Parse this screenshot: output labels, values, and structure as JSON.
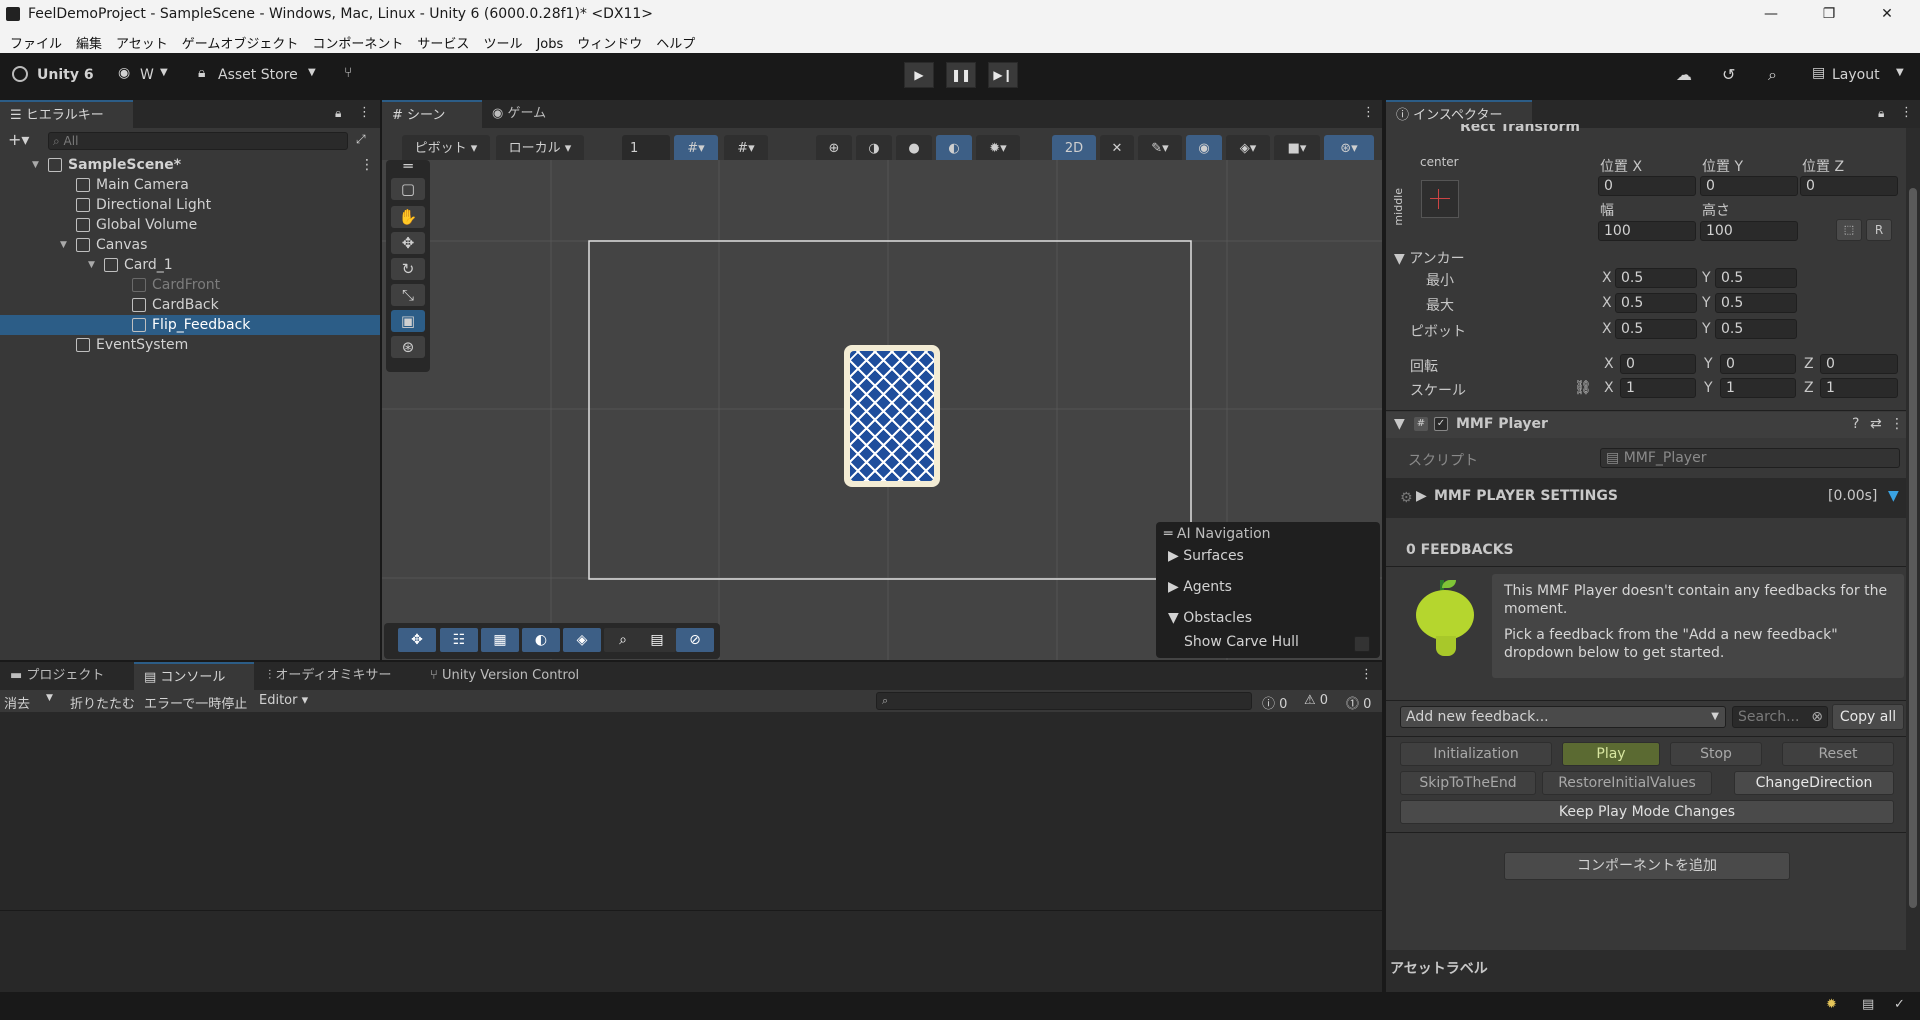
{
  "window": {
    "title": "FeelDemoProject - SampleScene - Windows, Mac, Linux - Unity 6 (6000.0.28f1)* <DX11>",
    "minimize": "—",
    "maximize": "❐",
    "close": "✕"
  },
  "menu": [
    "ファイル",
    "編集",
    "アセット",
    "ゲームオブジェクト",
    "コンポーネント",
    "サービス",
    "ツール",
    "Jobs",
    "ウィンドウ",
    "ヘルプ"
  ],
  "toolbar": {
    "unity_label": "Unity 6",
    "account_label": "W",
    "asset_store_label": "Asset Store",
    "layout_label": "Layout"
  },
  "hierarchy": {
    "tab": "ヒエラルキー",
    "search_placeholder": "All",
    "items": [
      {
        "label": "SampleScene*",
        "level": 0,
        "bold": true
      },
      {
        "label": "Main Camera",
        "level": 1
      },
      {
        "label": "Directional Light",
        "level": 1
      },
      {
        "label": "Global Volume",
        "level": 1
      },
      {
        "label": "Canvas",
        "level": 1
      },
      {
        "label": "Card_1",
        "level": 2
      },
      {
        "label": "CardFront",
        "level": 3,
        "disabled": true
      },
      {
        "label": "CardBack",
        "level": 3
      },
      {
        "label": "Flip_Feedback",
        "level": 3,
        "selected": true
      },
      {
        "label": "EventSystem",
        "level": 1
      }
    ]
  },
  "scene": {
    "tab_scene": "シーン",
    "tab_game": "ゲーム",
    "pivot_label": "ピボット",
    "local_label": "ローカル",
    "grid_value": "1",
    "btn_2d": "2D",
    "overlay": {
      "title": "AI Navigation",
      "surfaces": "Surfaces",
      "agents": "Agents",
      "obstacles": "Obstacles",
      "show_carve_hull": "Show Carve Hull"
    }
  },
  "bottom": {
    "tabs": [
      "プロジェクト",
      "コンソール",
      "オーディオミキサー",
      "Unity Version Control"
    ],
    "clear": "消去",
    "collapse": "折りたたむ",
    "pause_on_error": "エラーで一時停止",
    "editor": "Editor",
    "count_log": "0",
    "count_warn": "0",
    "count_err": "0"
  },
  "inspector": {
    "tab": "インスペクター",
    "rect_transform": {
      "title": "Rect Transform",
      "anchor_h": "center",
      "anchor_v": "middle",
      "pos_x_label": "位置 X",
      "pos_y_label": "位置 Y",
      "pos_z_label": "位置 Z",
      "pos_x": "0",
      "pos_y": "0",
      "pos_z": "0",
      "width_label": "幅",
      "height_label": "高さ",
      "width": "100",
      "height": "100",
      "anchors_label": "アンカー",
      "min_label": "最小",
      "max_label": "最大",
      "pivot_label": "ピボット",
      "min_x": "0.5",
      "min_y": "0.5",
      "max_x": "0.5",
      "max_y": "0.5",
      "pivot_x": "0.5",
      "pivot_y": "0.5",
      "rotation_label": "回転",
      "scale_label": "スケール",
      "rot_x": "0",
      "rot_y": "0",
      "rot_z": "0",
      "scale_x": "1",
      "scale_y": "1",
      "scale_z": "1",
      "x": "X",
      "y": "Y",
      "z": "Z",
      "r_btn": "R"
    },
    "mmf": {
      "title": "MMF Player",
      "script_label": "スクリプト",
      "script_value": "MMF_Player",
      "settings": "MMF PLAYER SETTINGS",
      "duration": "[0.00s]",
      "feedbacks": "0 FEEDBACKS",
      "msg1": "This MMF Player doesn't contain any feedbacks for the moment.",
      "msg2": "Pick a feedback from the \"Add a new feedback\" dropdown below to get started.",
      "add_feedback": "Add new feedback...",
      "search_placeholder": "Search...",
      "copy_all": "Copy all",
      "buttons": {
        "initialization": "Initialization",
        "play": "Play",
        "stop": "Stop",
        "reset": "Reset",
        "skip": "SkipToTheEnd",
        "restore": "RestoreInitialValues",
        "change_dir": "ChangeDirection",
        "keep": "Keep Play Mode Changes"
      }
    },
    "add_component": "コンポーネントを追加",
    "asset_labels": "アセットラベル"
  },
  "colors": {
    "selection": "#2c5d87",
    "play_green": "#5b6a32",
    "card_blue": "#1f4e9c"
  }
}
